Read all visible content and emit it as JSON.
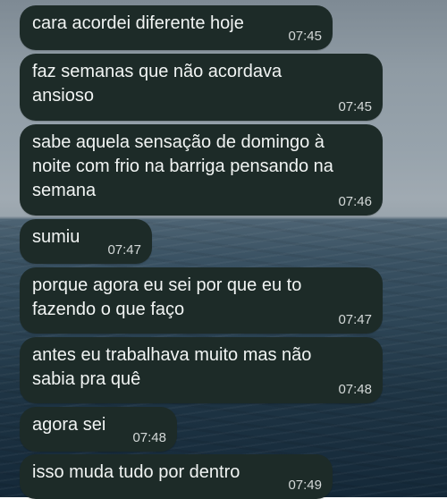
{
  "messages": [
    {
      "text": "cara acordei diferente hoje",
      "time": "07:45"
    },
    {
      "text": "faz semanas que não acordava\nansioso",
      "time": "07:45"
    },
    {
      "text": "sabe aquela sensação de domingo à\nnoite com frio na barriga pensando na\nsemana",
      "time": "07:46"
    },
    {
      "text": "sumiu",
      "time": "07:47"
    },
    {
      "text": "porque agora eu sei por que eu to\nfazendo o que faço",
      "time": "07:47"
    },
    {
      "text": "antes eu trabalhava muito mas não\nsabia pra quê",
      "time": "07:48"
    },
    {
      "text": "agora sei",
      "time": "07:48"
    },
    {
      "text": "isso muda tudo por dentro",
      "time": "07:49"
    }
  ],
  "colors": {
    "bubble_background": "#1d2b28",
    "message_text": "#f1f4f3",
    "timestamp_text": "#d4d9d8"
  },
  "wallpaper": "ocean-horizon-photo"
}
